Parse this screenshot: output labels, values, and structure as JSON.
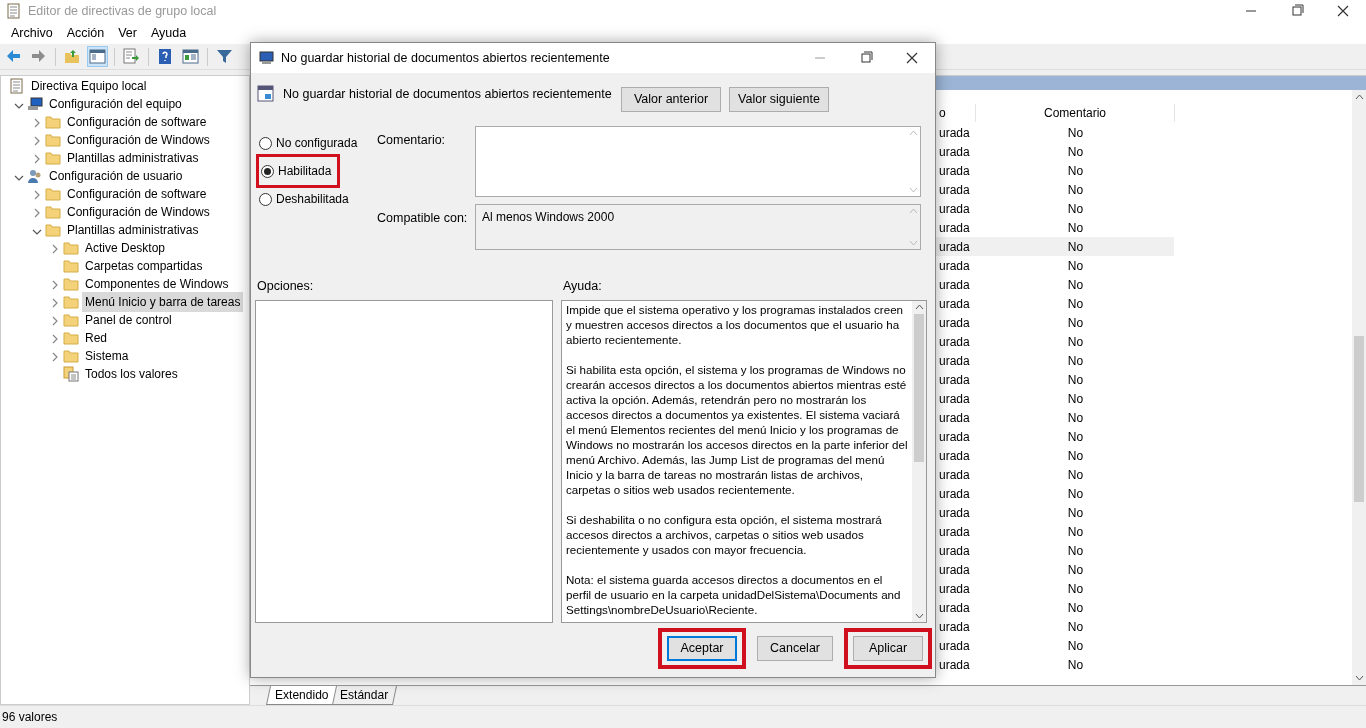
{
  "window": {
    "title": "Editor de directivas de grupo local"
  },
  "menu": [
    "Archivo",
    "Acción",
    "Ver",
    "Ayuda"
  ],
  "tree": [
    {
      "label": "Directiva Equipo local",
      "kind": "policy",
      "selected": false,
      "children": [
        {
          "label": "Configuración del equipo",
          "kind": "computer",
          "expanded": true,
          "selected": false,
          "children": [
            {
              "label": "Configuración de software",
              "kind": "folder",
              "expanded": false,
              "selected": false
            },
            {
              "label": "Configuración de Windows",
              "kind": "folder",
              "expanded": false,
              "selected": false
            },
            {
              "label": "Plantillas administrativas",
              "kind": "folder",
              "expanded": false,
              "selected": false
            }
          ]
        },
        {
          "label": "Configuración de usuario",
          "kind": "user",
          "expanded": true,
          "selected": false,
          "children": [
            {
              "label": "Configuración de software",
              "kind": "folder",
              "expanded": false,
              "selected": false
            },
            {
              "label": "Configuración de Windows",
              "kind": "folder",
              "expanded": false,
              "selected": false
            },
            {
              "label": "Plantillas administrativas",
              "kind": "folder",
              "expanded": true,
              "selected": false,
              "children": [
                {
                  "label": "Active Desktop",
                  "kind": "folder",
                  "expanded": false,
                  "selected": false
                },
                {
                  "label": "Carpetas compartidas",
                  "kind": "folder",
                  "selected": false
                },
                {
                  "label": "Componentes de Windows",
                  "kind": "folder",
                  "expanded": false,
                  "selected": false
                },
                {
                  "label": "Menú Inicio y barra de tareas",
                  "kind": "folder",
                  "expanded": false,
                  "selected": true
                },
                {
                  "label": "Panel de control",
                  "kind": "folder",
                  "expanded": false,
                  "selected": false
                },
                {
                  "label": "Red",
                  "kind": "folder",
                  "expanded": false,
                  "selected": false
                },
                {
                  "label": "Sistema",
                  "kind": "folder",
                  "expanded": false,
                  "selected": false
                },
                {
                  "label": "Todos los valores",
                  "kind": "settings",
                  "selected": false
                }
              ]
            }
          ]
        }
      ]
    }
  ],
  "list": {
    "columns": [
      "o",
      "Comentario"
    ],
    "rows": [
      {
        "column_1": "urada",
        "comment": "No",
        "selected": false
      },
      {
        "column_1": "urada",
        "comment": "No",
        "selected": false
      },
      {
        "column_1": "urada",
        "comment": "No",
        "selected": false
      },
      {
        "column_1": "urada",
        "comment": "No",
        "selected": false
      },
      {
        "column_1": "urada",
        "comment": "No",
        "selected": false
      },
      {
        "column_1": "urada",
        "comment": "No",
        "selected": false
      },
      {
        "column_1": "urada",
        "comment": "No",
        "selected": true
      },
      {
        "column_1": "urada",
        "comment": "No",
        "selected": false
      },
      {
        "column_1": "urada",
        "comment": "No",
        "selected": false
      },
      {
        "column_1": "urada",
        "comment": "No",
        "selected": false
      },
      {
        "column_1": "urada",
        "comment": "No",
        "selected": false
      },
      {
        "column_1": "urada",
        "comment": "No",
        "selected": false
      },
      {
        "column_1": "urada",
        "comment": "No",
        "selected": false
      },
      {
        "column_1": "urada",
        "comment": "No",
        "selected": false
      },
      {
        "column_1": "urada",
        "comment": "No",
        "selected": false
      },
      {
        "column_1": "urada",
        "comment": "No",
        "selected": false
      },
      {
        "column_1": "urada",
        "comment": "No",
        "selected": false
      },
      {
        "column_1": "urada",
        "comment": "No",
        "selected": false
      },
      {
        "column_1": "urada",
        "comment": "No",
        "selected": false
      },
      {
        "column_1": "urada",
        "comment": "No",
        "selected": false
      },
      {
        "column_1": "urada",
        "comment": "No",
        "selected": false
      },
      {
        "column_1": "urada",
        "comment": "No",
        "selected": false
      },
      {
        "column_1": "urada",
        "comment": "No",
        "selected": false
      },
      {
        "column_1": "urada",
        "comment": "No",
        "selected": false
      },
      {
        "column_1": "urada",
        "comment": "No",
        "selected": false
      },
      {
        "column_1": "urada",
        "comment": "No",
        "selected": false
      },
      {
        "column_1": "urada",
        "comment": "No",
        "selected": false
      },
      {
        "column_1": "urada",
        "comment": "No",
        "selected": false
      },
      {
        "column_1": "urada",
        "comment": "No",
        "selected": false
      }
    ]
  },
  "view_tabs": [
    {
      "label": "Extendido",
      "selected": true
    },
    {
      "label": "Estándar",
      "selected": false
    }
  ],
  "status_bar": "96 valores",
  "dialog": {
    "title": "No guardar historial de documentos abiertos recientemente",
    "setting_name": "No guardar historial de documentos abiertos recientemente",
    "nav_buttons": [
      "Valor anterior",
      "Valor siguiente"
    ],
    "options": [
      {
        "label": "No configurada",
        "selected": false,
        "highlighted": false
      },
      {
        "label": "Habilitada",
        "selected": true,
        "highlighted": true
      },
      {
        "label": "Deshabilitada",
        "selected": false,
        "highlighted": false
      }
    ],
    "comment_label": "Comentario:",
    "compatible_label": "Compatible con:",
    "compatible_value": "Al menos Windows 2000",
    "options_label": "Opciones:",
    "help_label": "Ayuda:",
    "help_text": [
      "Impide que el sistema operativo y los programas instalados creen y muestren accesos directos a los documentos que el usuario ha abierto recientemente.",
      "Si habilita esta opción, el sistema y los programas de Windows no crearán accesos directos a los documentos abiertos mientras esté activa la opción. Además, retendrán pero no mostrarán los accesos directos a documentos ya existentes. El sistema vaciará el menú Elementos recientes del menú Inicio y los programas de Windows no mostrarán los accesos directos en la parte inferior del menú Archivo. Además, las Jump List de programas del menú Inicio y la barra de tareas no mostrarán listas de archivos, carpetas o sitios web usados recientemente.",
      "Si deshabilita o no configura esta opción, el sistema mostrará accesos directos a archivos, carpetas o sitios web usados recientemente y usados con mayor frecuencia.",
      "Nota: el sistema guarda accesos directos a documentos en el perfil de usuario en la carpeta unidadDelSistema\\Documents and Settings\\nombreDeUsuario\\Reciente."
    ],
    "buttons": [
      {
        "label": "Aceptar",
        "default": true,
        "highlighted": true
      },
      {
        "label": "Cancelar",
        "default": false,
        "highlighted": false
      },
      {
        "label": "Aplicar",
        "default": false,
        "highlighted": true
      }
    ]
  }
}
